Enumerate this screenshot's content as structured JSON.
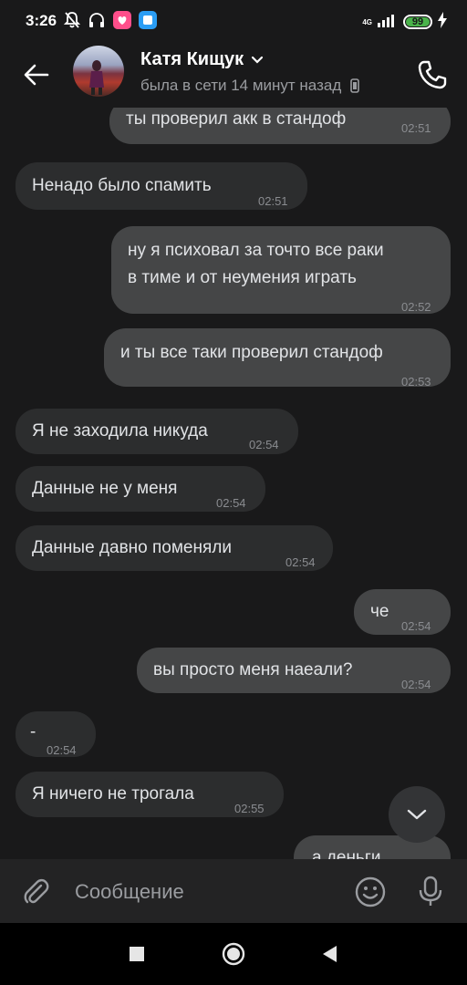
{
  "status_bar": {
    "time": "3:26",
    "network_label": "4G",
    "battery": "99"
  },
  "header": {
    "contact_name": "Катя Кищук",
    "last_seen": "была в сети 14 минут назад"
  },
  "messages": [
    {
      "direction": "out",
      "text": "ты проверил акк в стандоф",
      "time": "02:51"
    },
    {
      "direction": "in",
      "text": "Ненадо было спамить",
      "time": "02:51"
    },
    {
      "direction": "out",
      "line1": "ну я психовал за точто все раки",
      "line2": "в тиме и от неумения играть",
      "time": "02:52"
    },
    {
      "direction": "out",
      "text": "и ты все таки проверил стандоф",
      "time": "02:53"
    },
    {
      "direction": "in",
      "text": "Я не заходила никуда",
      "time": "02:54"
    },
    {
      "direction": "in",
      "text": "Данные не у меня",
      "time": "02:54"
    },
    {
      "direction": "in",
      "text": "Данные давно поменяли",
      "time": "02:54"
    },
    {
      "direction": "out",
      "text": "че",
      "time": "02:54"
    },
    {
      "direction": "out",
      "text": "вы просто меня наеали?",
      "time": "02:54"
    },
    {
      "direction": "in",
      "text": "-",
      "time": "02:54"
    },
    {
      "direction": "in",
      "text": "Я ничего не трогала",
      "time": "02:55"
    },
    {
      "direction": "out",
      "text": "а деньги"
    }
  ],
  "composer": {
    "placeholder": "Сообщение"
  },
  "colors": {
    "background": "#19191a",
    "incoming_bubble": "#2c2d2e",
    "outgoing_bubble": "#454647",
    "battery_green": "#4bb34b"
  },
  "icons": {
    "back": "arrow-left-icon",
    "call": "phone-icon",
    "attach": "paperclip-icon",
    "emoji": "smile-icon",
    "mic": "microphone-icon",
    "scroll_down": "chevron-down-icon"
  }
}
